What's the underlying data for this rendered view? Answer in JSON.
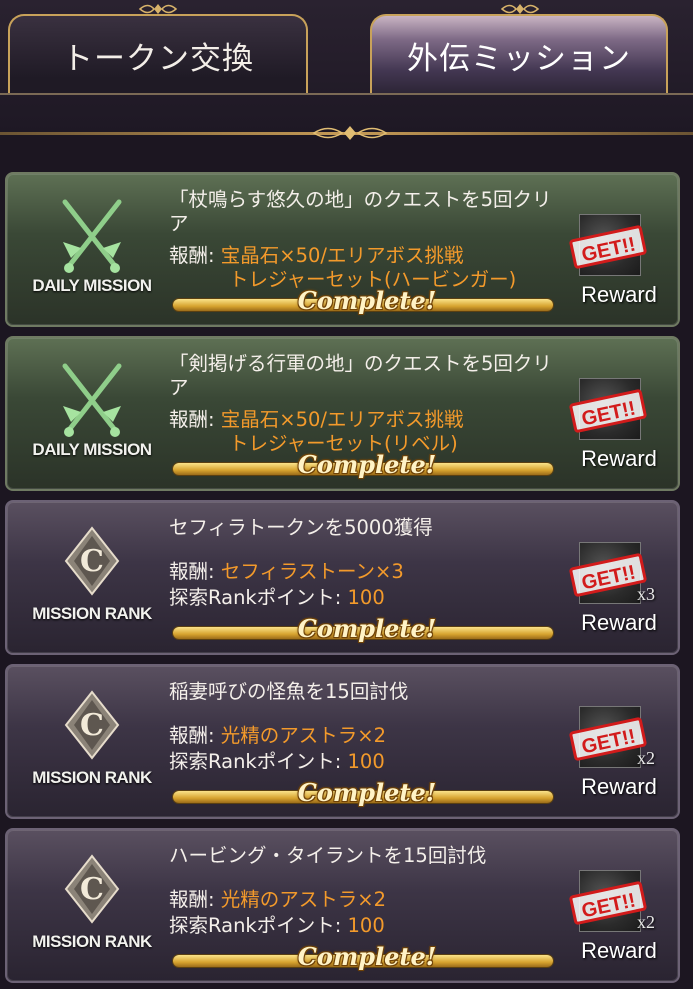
{
  "tabs": [
    {
      "label": "トークン交換",
      "active": false
    },
    {
      "label": "外伝ミッション",
      "active": true
    }
  ],
  "colors": {
    "reward_orange": "#f39a2b",
    "daily_bg": "#3a4836",
    "rank_bg": "#3d3546",
    "gold": "#d7a32f"
  },
  "missions": [
    {
      "kind": "daily",
      "emblem_label": "DAILY MISSION",
      "emblem_icon": "crossed-swords-icon",
      "title": "「杖鳴らす悠久の地」のクエストを5回クリア",
      "reward_prefix": "報酬: ",
      "reward_line1": "宝晶石×50/エリアボス挑戦",
      "reward_line2": "トレジャーセット(ハービンガー)",
      "rank_prefix": "",
      "rank_value": "",
      "status": "Complete!",
      "stamp": "GET!!",
      "reward_label": "Reward",
      "qty": ""
    },
    {
      "kind": "daily",
      "emblem_label": "DAILY MISSION",
      "emblem_icon": "crossed-swords-icon",
      "title": "「剣掲げる行軍の地」のクエストを5回クリア",
      "reward_prefix": "報酬: ",
      "reward_line1": "宝晶石×50/エリアボス挑戦",
      "reward_line2": "トレジャーセット(リベル)",
      "rank_prefix": "",
      "rank_value": "",
      "status": "Complete!",
      "stamp": "GET!!",
      "reward_label": "Reward",
      "qty": ""
    },
    {
      "kind": "rank",
      "emblem_label": "MISSION RANK",
      "emblem_icon": "rank-c-icon",
      "title": "セフィラトークンを5000獲得",
      "reward_prefix": "報酬: ",
      "reward_line1": "セフィラストーン×3",
      "reward_line2": "",
      "rank_prefix": "探索Rankポイント: ",
      "rank_value": "100",
      "status": "Complete!",
      "stamp": "GET!!",
      "reward_label": "Reward",
      "qty": "x3"
    },
    {
      "kind": "rank",
      "emblem_label": "MISSION RANK",
      "emblem_icon": "rank-c-icon",
      "title": "稲妻呼びの怪魚を15回討伐",
      "reward_prefix": "報酬: ",
      "reward_line1": "光精のアストラ×2",
      "reward_line2": "",
      "rank_prefix": "探索Rankポイント: ",
      "rank_value": "100",
      "status": "Complete!",
      "stamp": "GET!!",
      "reward_label": "Reward",
      "qty": "x2"
    },
    {
      "kind": "rank",
      "emblem_label": "MISSION RANK",
      "emblem_icon": "rank-c-icon",
      "title": "ハービング・タイラントを15回討伐",
      "reward_prefix": "報酬: ",
      "reward_line1": "光精のアストラ×2",
      "reward_line2": "",
      "rank_prefix": "探索Rankポイント: ",
      "rank_value": "100",
      "status": "Complete!",
      "stamp": "GET!!",
      "reward_label": "Reward",
      "qty": "x2"
    }
  ]
}
